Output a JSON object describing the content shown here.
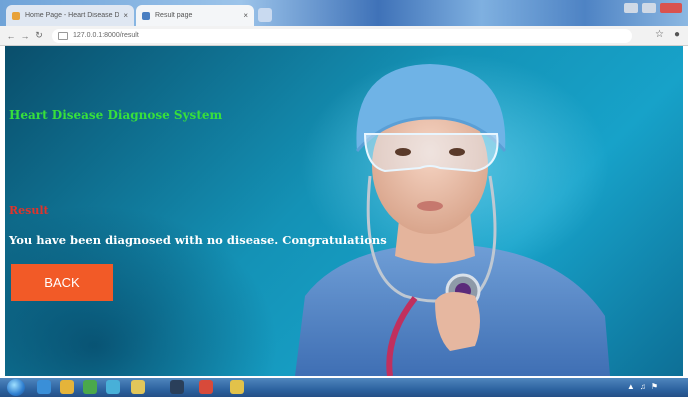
{
  "browser": {
    "tabs": [
      {
        "label": "Home Page - Heart Disease Di...",
        "close": "×"
      },
      {
        "label": "Result page",
        "close": "×"
      }
    ],
    "url": "127.0.0.1:8000/result"
  },
  "page": {
    "title": "Heart Disease Diagnose System",
    "result_label": "Result",
    "result_text": "You have been diagnosed with no disease. Congratulations",
    "back_button": "BACK"
  },
  "colors": {
    "title": "#37e03b",
    "result_label": "#e0342b",
    "back_button": "#f25a27",
    "background": "#1492b6"
  },
  "icons": [
    "back-arrow-icon",
    "forward-arrow-icon",
    "reload-icon",
    "star-icon",
    "account-icon"
  ]
}
